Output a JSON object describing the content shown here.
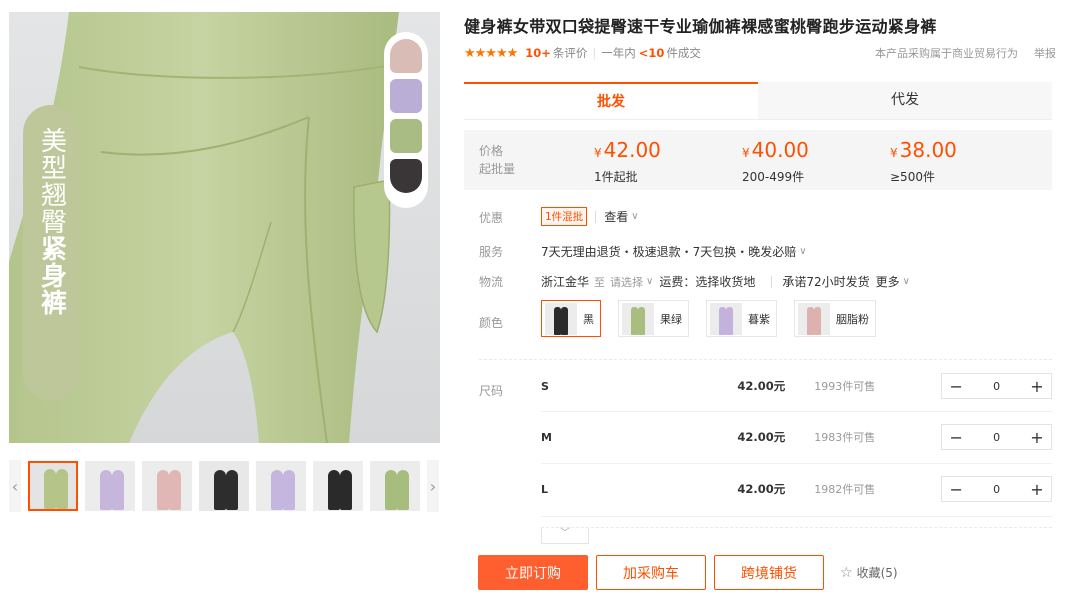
{
  "product": {
    "title": "健身裤女带双口袋提臀速干专业瑜伽裤裸感蜜桃臀跑步运动紧身裤",
    "stars": "★★★★★",
    "review_count": "10+",
    "review_suffix": "条评价",
    "sales_prefix": "一年内",
    "sales_count": "<10",
    "sales_suffix": "件成交",
    "trade_note": "本产品采购属于商业贸易行为",
    "report_label": "举报"
  },
  "gallery": {
    "slogan_line1": "美型翘臀",
    "slogan_line2": "紧身裤",
    "swatch_colors": [
      "#d9bcb6",
      "#bbaed6",
      "#a9bc84",
      "#3a3638"
    ],
    "prev_arrow": "‹",
    "next_arrow": "›",
    "thumbs": [
      {
        "bg": "#e4e4e4",
        "leg": "#b5c589"
      },
      {
        "bg": "#ececec",
        "leg": "#c7b6dc"
      },
      {
        "bg": "#ececec",
        "leg": "#e0b7b5"
      },
      {
        "bg": "#e8e8e8",
        "leg": "#2d2d2d"
      },
      {
        "bg": "#ececec",
        "leg": "#c5b6df"
      },
      {
        "bg": "#eeeeee",
        "leg": "#2a2a2a"
      },
      {
        "bg": "#ececec",
        "leg": "#a6bd7d"
      }
    ]
  },
  "tabs": {
    "wholesale": "批发",
    "dropship": "代发"
  },
  "pricing": {
    "price_label": "价格",
    "moq_label": "起批量",
    "currency": "¥",
    "tiers": [
      {
        "price": "42.00",
        "range": "1件起批"
      },
      {
        "price": "40.00",
        "range": "200-499件"
      },
      {
        "price": "38.00",
        "range": "≥500件"
      }
    ]
  },
  "specs": {
    "promo_label": "优惠",
    "promo_badge": "1件混批",
    "promo_view": "查看",
    "service_label": "服务",
    "service_value": "7天无理由退货・极速退款・7天包换・晚发必赔",
    "logistics_label": "物流",
    "origin": "浙江金华",
    "to_label": "至",
    "dest_placeholder": "请选择",
    "freight": "运费：选择收货地",
    "ship_promise": "承诺72小时发货",
    "more_label": "更多",
    "color_label": "颜色",
    "size_label": "尺码"
  },
  "colors": [
    {
      "name": "黑",
      "leg": "#2b2b2b"
    },
    {
      "name": "果绿",
      "leg": "#a8bd7e"
    },
    {
      "name": "暮紫",
      "leg": "#c3b3dc"
    },
    {
      "name": "胭脂粉",
      "leg": "#dcb1ae"
    }
  ],
  "sizes": [
    {
      "name": "S",
      "price": "42.00元",
      "stock": "1993件可售",
      "qty": "0"
    },
    {
      "name": "M",
      "price": "42.00元",
      "stock": "1983件可售",
      "qty": "0"
    },
    {
      "name": "L",
      "price": "42.00元",
      "stock": "1982件可售",
      "qty": "0"
    }
  ],
  "stepper": {
    "minus": "−",
    "plus": "+"
  },
  "expand_icon": "﹀",
  "actions": {
    "order": "立即订购",
    "cart": "加采购车",
    "crossborder": "跨境铺货",
    "fav_icon": "☆",
    "fav": "收藏(5)"
  }
}
